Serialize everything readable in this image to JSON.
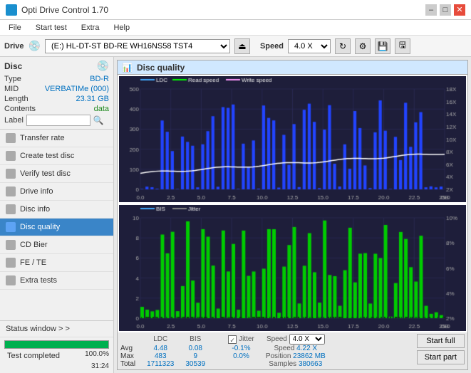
{
  "window": {
    "title": "Opti Drive Control 1.70",
    "min_btn": "–",
    "max_btn": "□",
    "close_btn": "✕"
  },
  "menu": {
    "items": [
      "File",
      "Start test",
      "Extra",
      "Help"
    ]
  },
  "toolbar": {
    "drive_label": "Drive",
    "drive_value": "(E:)  HL-DT-ST BD-RE  WH16NS58 TST4",
    "speed_label": "Speed",
    "speed_value": "4.0 X"
  },
  "disc_panel": {
    "title": "Disc",
    "type_label": "Type",
    "type_value": "BD-R",
    "mid_label": "MID",
    "mid_value": "VERBATIMe (000)",
    "length_label": "Length",
    "length_value": "23.31 GB",
    "contents_label": "Contents",
    "contents_value": "data",
    "label_label": "Label"
  },
  "nav": {
    "items": [
      {
        "id": "transfer-rate",
        "label": "Transfer rate"
      },
      {
        "id": "create-test-disc",
        "label": "Create test disc"
      },
      {
        "id": "verify-test-disc",
        "label": "Verify test disc"
      },
      {
        "id": "drive-info",
        "label": "Drive info"
      },
      {
        "id": "disc-info",
        "label": "Disc info"
      },
      {
        "id": "disc-quality",
        "label": "Disc quality",
        "active": true
      },
      {
        "id": "cd-bier",
        "label": "CD Bier"
      },
      {
        "id": "fe-te",
        "label": "FE / TE"
      },
      {
        "id": "extra-tests",
        "label": "Extra tests"
      }
    ]
  },
  "status_window": {
    "label": "Status window > >"
  },
  "progress": {
    "value": 100,
    "text": "100.0%"
  },
  "bottom_status": {
    "text": "Test completed",
    "time": "31:24"
  },
  "chart_panel": {
    "title": "Disc quality",
    "legend_upper": [
      "LDC",
      "Read speed",
      "Write speed"
    ],
    "legend_lower": [
      "BIS",
      "Jitter"
    ],
    "x_max": "25.0",
    "x_label": "GB",
    "upper": {
      "y_left_max": 500,
      "y_right_labels": [
        "18X",
        "16X",
        "14X",
        "12X",
        "10X",
        "8X",
        "6X",
        "4X",
        "2X"
      ],
      "x_ticks": [
        "0.0",
        "2.5",
        "5.0",
        "7.5",
        "10.0",
        "12.5",
        "15.0",
        "17.5",
        "20.0",
        "22.5",
        "25.0 GB"
      ]
    },
    "lower": {
      "y_left_max": 10,
      "y_right_labels": [
        "10%",
        "8%",
        "6%",
        "4%",
        "2%"
      ],
      "x_ticks": [
        "0.0",
        "2.5",
        "5.0",
        "7.5",
        "10.0",
        "12.5",
        "15.0",
        "17.5",
        "20.0",
        "22.5",
        "25.0 GB"
      ]
    }
  },
  "stats": {
    "col_headers": [
      "LDC",
      "BIS",
      "",
      "Jitter",
      "Speed"
    ],
    "avg_label": "Avg",
    "avg_ldc": "4.48",
    "avg_bis": "0.08",
    "avg_jitter": "-0.1%",
    "max_label": "Max",
    "max_ldc": "483",
    "max_bis": "9",
    "max_jitter": "0.0%",
    "total_label": "Total",
    "total_ldc": "1711323",
    "total_bis": "30539",
    "speed_label": "Speed",
    "speed_val": "4.22 X",
    "speed_select": "4.0 X",
    "position_label": "Position",
    "position_val": "23862 MB",
    "samples_label": "Samples",
    "samples_val": "380663",
    "jitter_checked": true,
    "jitter_label": "Jitter"
  },
  "buttons": {
    "start_full": "Start full",
    "start_part": "Start part"
  }
}
